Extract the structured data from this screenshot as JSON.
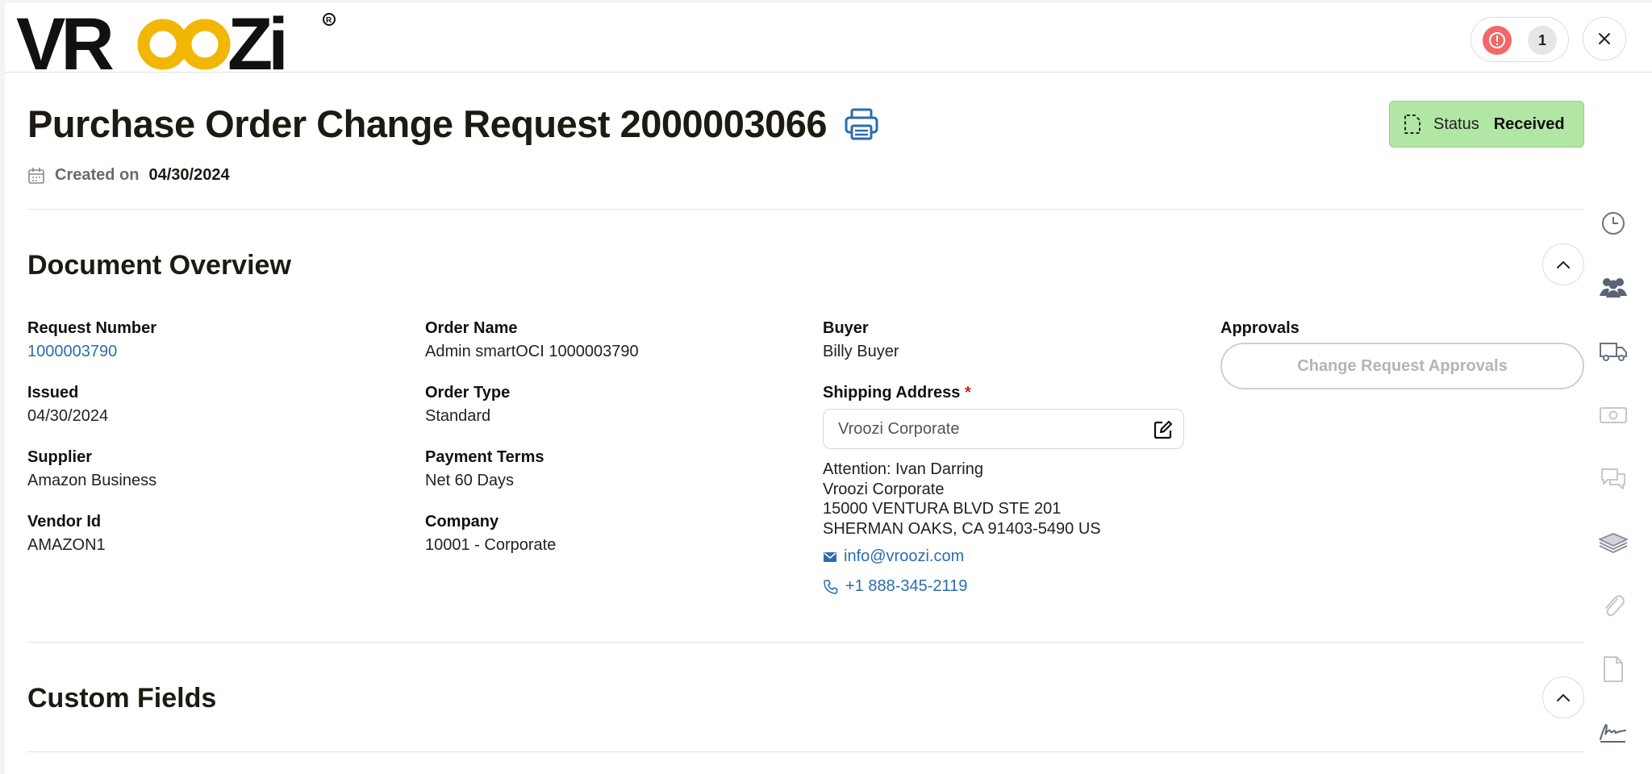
{
  "app": {
    "logo_text": "VROOZI"
  },
  "topbar": {
    "alert_count": "1"
  },
  "header": {
    "title": "Purchase Order Change Request 2000003066",
    "created_label": "Created on",
    "created_date": "04/30/2024",
    "status_label": "Status",
    "status_value": "Received"
  },
  "overview": {
    "title": "Document Overview",
    "request_number_label": "Request Number",
    "request_number": "1000003790",
    "issued_label": "Issued",
    "issued": "04/30/2024",
    "supplier_label": "Supplier",
    "supplier": "Amazon Business",
    "vendor_id_label": "Vendor Id",
    "vendor_id": "AMAZON1",
    "order_name_label": "Order Name",
    "order_name": "Admin smartOCI 1000003790",
    "order_type_label": "Order Type",
    "order_type": "Standard",
    "payment_terms_label": "Payment Terms",
    "payment_terms": "Net 60 Days",
    "company_label": "Company",
    "company": "10001 - Corporate",
    "buyer_label": "Buyer",
    "buyer": "Billy Buyer",
    "shipping_label": "Shipping Address",
    "shipping_required": "*",
    "shipping_value": "Vroozi Corporate",
    "address": {
      "attention": "Attention: Ivan Darring",
      "line1": "Vroozi Corporate",
      "line2": "15000 VENTURA BLVD STE 201",
      "line3": "SHERMAN OAKS, CA 91403-5490 US"
    },
    "email": "info@vroozi.com",
    "phone": "+1 888-345-2119",
    "approvals_label": "Approvals",
    "approvals_button": "Change Request Approvals"
  },
  "custom_fields": {
    "title": "Custom Fields"
  },
  "colors": {
    "status_bg": "#b2e6a4",
    "link": "#2b6cb0",
    "alert": "#f26767",
    "logo_accent": "#f2b705"
  },
  "rail_icons": [
    "clock-icon",
    "users-icon",
    "truck-icon",
    "money-icon",
    "comments-icon",
    "stack-icon",
    "paperclip-icon",
    "document-icon",
    "signature-icon"
  ]
}
